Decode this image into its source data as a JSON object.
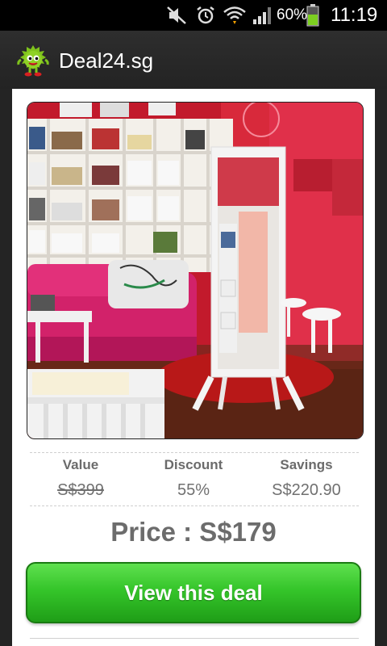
{
  "status_bar": {
    "battery_percent": "60%",
    "time": "11:19",
    "icons": [
      "muted-icon",
      "alarm-icon",
      "wifi-icon",
      "signal-icon",
      "battery-icon"
    ]
  },
  "app": {
    "title": "Deal24.sg",
    "logo_icon": "mascot-icon"
  },
  "deal": {
    "image_alt_icon": "product-photo",
    "stats": [
      {
        "label": "Value",
        "value": "S$399"
      },
      {
        "label": "Discount",
        "value": "55%"
      },
      {
        "label": "Savings",
        "value": "S$220.90"
      }
    ],
    "price": "Price : S$179",
    "button_label": "View this deal"
  },
  "colors": {
    "button_green": "#35c52a",
    "text_gray": "#6c6c6c",
    "action_bar": "#2e2e2e"
  }
}
